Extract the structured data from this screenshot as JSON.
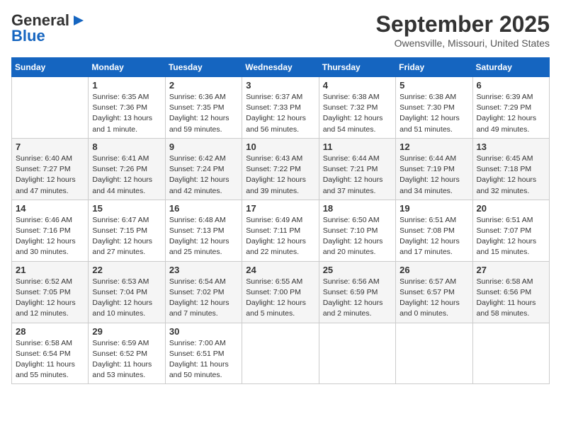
{
  "header": {
    "logo_general": "General",
    "logo_blue": "Blue",
    "month": "September 2025",
    "location": "Owensville, Missouri, United States"
  },
  "weekdays": [
    "Sunday",
    "Monday",
    "Tuesday",
    "Wednesday",
    "Thursday",
    "Friday",
    "Saturday"
  ],
  "weeks": [
    [
      {
        "day": "",
        "info": ""
      },
      {
        "day": "1",
        "info": "Sunrise: 6:35 AM\nSunset: 7:36 PM\nDaylight: 13 hours\nand 1 minute."
      },
      {
        "day": "2",
        "info": "Sunrise: 6:36 AM\nSunset: 7:35 PM\nDaylight: 12 hours\nand 59 minutes."
      },
      {
        "day": "3",
        "info": "Sunrise: 6:37 AM\nSunset: 7:33 PM\nDaylight: 12 hours\nand 56 minutes."
      },
      {
        "day": "4",
        "info": "Sunrise: 6:38 AM\nSunset: 7:32 PM\nDaylight: 12 hours\nand 54 minutes."
      },
      {
        "day": "5",
        "info": "Sunrise: 6:38 AM\nSunset: 7:30 PM\nDaylight: 12 hours\nand 51 minutes."
      },
      {
        "day": "6",
        "info": "Sunrise: 6:39 AM\nSunset: 7:29 PM\nDaylight: 12 hours\nand 49 minutes."
      }
    ],
    [
      {
        "day": "7",
        "info": "Sunrise: 6:40 AM\nSunset: 7:27 PM\nDaylight: 12 hours\nand 47 minutes."
      },
      {
        "day": "8",
        "info": "Sunrise: 6:41 AM\nSunset: 7:26 PM\nDaylight: 12 hours\nand 44 minutes."
      },
      {
        "day": "9",
        "info": "Sunrise: 6:42 AM\nSunset: 7:24 PM\nDaylight: 12 hours\nand 42 minutes."
      },
      {
        "day": "10",
        "info": "Sunrise: 6:43 AM\nSunset: 7:22 PM\nDaylight: 12 hours\nand 39 minutes."
      },
      {
        "day": "11",
        "info": "Sunrise: 6:44 AM\nSunset: 7:21 PM\nDaylight: 12 hours\nand 37 minutes."
      },
      {
        "day": "12",
        "info": "Sunrise: 6:44 AM\nSunset: 7:19 PM\nDaylight: 12 hours\nand 34 minutes."
      },
      {
        "day": "13",
        "info": "Sunrise: 6:45 AM\nSunset: 7:18 PM\nDaylight: 12 hours\nand 32 minutes."
      }
    ],
    [
      {
        "day": "14",
        "info": "Sunrise: 6:46 AM\nSunset: 7:16 PM\nDaylight: 12 hours\nand 30 minutes."
      },
      {
        "day": "15",
        "info": "Sunrise: 6:47 AM\nSunset: 7:15 PM\nDaylight: 12 hours\nand 27 minutes."
      },
      {
        "day": "16",
        "info": "Sunrise: 6:48 AM\nSunset: 7:13 PM\nDaylight: 12 hours\nand 25 minutes."
      },
      {
        "day": "17",
        "info": "Sunrise: 6:49 AM\nSunset: 7:11 PM\nDaylight: 12 hours\nand 22 minutes."
      },
      {
        "day": "18",
        "info": "Sunrise: 6:50 AM\nSunset: 7:10 PM\nDaylight: 12 hours\nand 20 minutes."
      },
      {
        "day": "19",
        "info": "Sunrise: 6:51 AM\nSunset: 7:08 PM\nDaylight: 12 hours\nand 17 minutes."
      },
      {
        "day": "20",
        "info": "Sunrise: 6:51 AM\nSunset: 7:07 PM\nDaylight: 12 hours\nand 15 minutes."
      }
    ],
    [
      {
        "day": "21",
        "info": "Sunrise: 6:52 AM\nSunset: 7:05 PM\nDaylight: 12 hours\nand 12 minutes."
      },
      {
        "day": "22",
        "info": "Sunrise: 6:53 AM\nSunset: 7:04 PM\nDaylight: 12 hours\nand 10 minutes."
      },
      {
        "day": "23",
        "info": "Sunrise: 6:54 AM\nSunset: 7:02 PM\nDaylight: 12 hours\nand 7 minutes."
      },
      {
        "day": "24",
        "info": "Sunrise: 6:55 AM\nSunset: 7:00 PM\nDaylight: 12 hours\nand 5 minutes."
      },
      {
        "day": "25",
        "info": "Sunrise: 6:56 AM\nSunset: 6:59 PM\nDaylight: 12 hours\nand 2 minutes."
      },
      {
        "day": "26",
        "info": "Sunrise: 6:57 AM\nSunset: 6:57 PM\nDaylight: 12 hours\nand 0 minutes."
      },
      {
        "day": "27",
        "info": "Sunrise: 6:58 AM\nSunset: 6:56 PM\nDaylight: 11 hours\nand 58 minutes."
      }
    ],
    [
      {
        "day": "28",
        "info": "Sunrise: 6:58 AM\nSunset: 6:54 PM\nDaylight: 11 hours\nand 55 minutes."
      },
      {
        "day": "29",
        "info": "Sunrise: 6:59 AM\nSunset: 6:52 PM\nDaylight: 11 hours\nand 53 minutes."
      },
      {
        "day": "30",
        "info": "Sunrise: 7:00 AM\nSunset: 6:51 PM\nDaylight: 11 hours\nand 50 minutes."
      },
      {
        "day": "",
        "info": ""
      },
      {
        "day": "",
        "info": ""
      },
      {
        "day": "",
        "info": ""
      },
      {
        "day": "",
        "info": ""
      }
    ]
  ]
}
